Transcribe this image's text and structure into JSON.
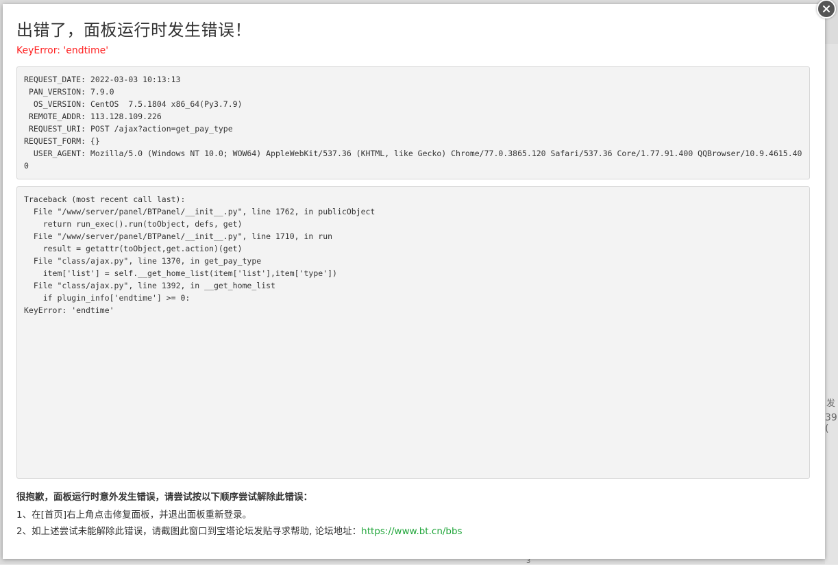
{
  "modal": {
    "title": "出错了，面板运行时发生错误！",
    "error_message": "KeyError: 'endtime'",
    "close_icon": "close-icon"
  },
  "request_info": [
    "REQUEST_DATE: 2022-03-03 10:13:13",
    " PAN_VERSION: 7.9.0",
    "  OS_VERSION: CentOS  7.5.1804 x86_64(Py3.7.9)",
    " REMOTE_ADDR: 113.128.109.226",
    " REQUEST_URI: POST /ajax?action=get_pay_type",
    "REQUEST_FORM: {}",
    "  USER_AGENT: Mozilla/5.0 (Windows NT 10.0; WOW64) AppleWebKit/537.36 (KHTML, like Gecko) Chrome/77.0.3865.120 Safari/537.36 Core/1.77.91.400 QQBrowser/10.9.4615.400"
  ],
  "traceback": [
    "Traceback (most recent call last):",
    "  File \"/www/server/panel/BTPanel/__init__.py\", line 1762, in publicObject",
    "    return run_exec().run(toObject, defs, get)",
    "  File \"/www/server/panel/BTPanel/__init__.py\", line 1710, in run",
    "    result = getattr(toObject,get.action)(get)",
    "  File \"class/ajax.py\", line 1370, in get_pay_type",
    "    item['list'] = self.__get_home_list(item['list'],item['type'])",
    "  File \"class/ajax.py\", line 1392, in __get_home_list",
    "    if plugin_info['endtime'] >= 0:",
    "KeyError: 'endtime'"
  ],
  "help": {
    "heading": "很抱歉，面板运行时意外发生错误，请尝试按以下顺序尝试解除此错误：",
    "step1": "1、在[首页]右上角点击修复面板，并退出面板重新登录。",
    "step2_prefix": "2、如上述尝试未能解除此错误，请截图此窗口到宝塔论坛发贴寻求帮助, 论坛地址：",
    "forum_link": "https://www.bt.cn/bbs"
  },
  "background": {
    "right_text_1": "发",
    "right_text_2": "39 (",
    "bottom_tick": "3"
  },
  "colors": {
    "error": "#ff1f1f",
    "link": "#20a53a",
    "code_bg": "#f3f3f3"
  }
}
